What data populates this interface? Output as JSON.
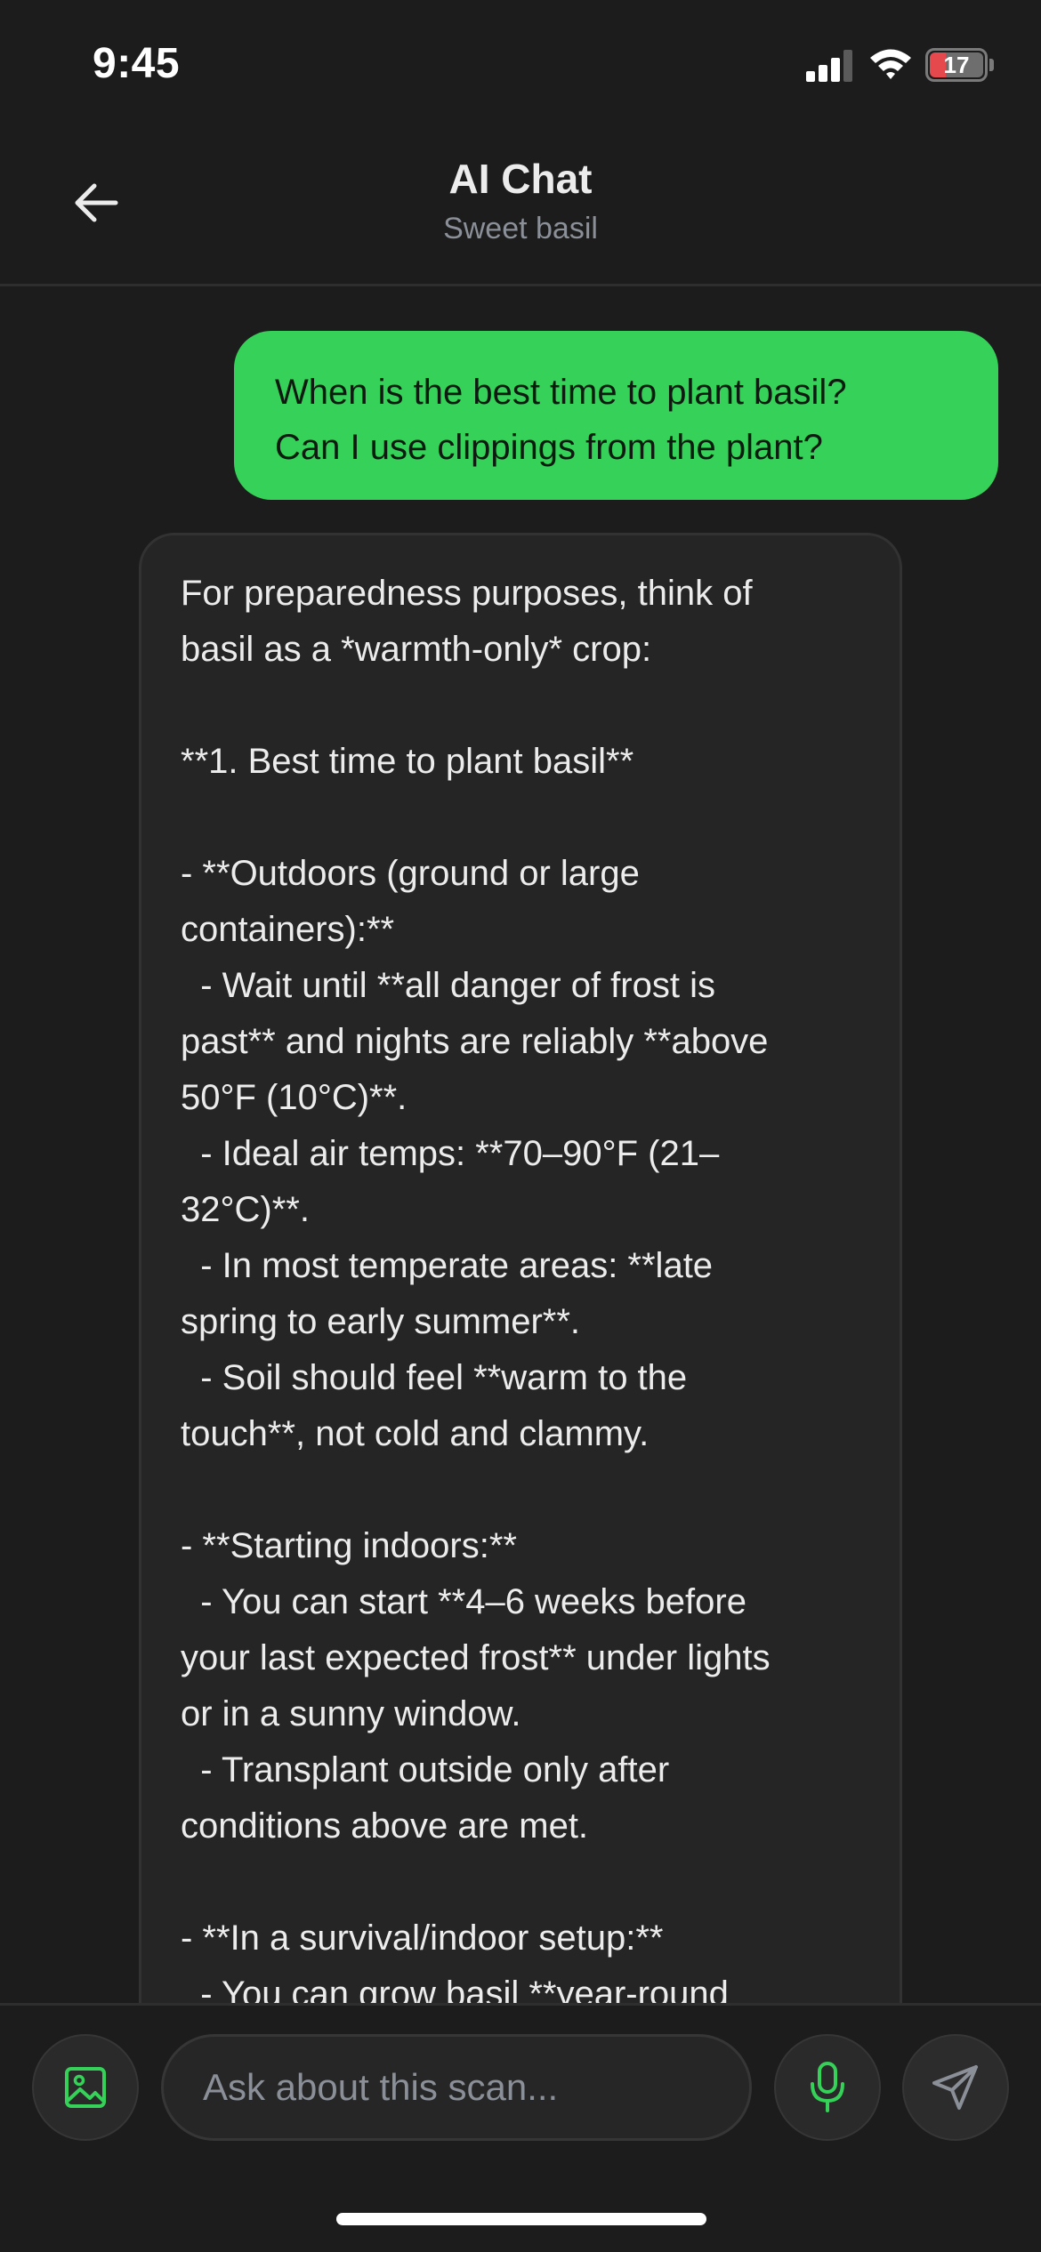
{
  "status_bar": {
    "time": "9:45",
    "battery": "17",
    "icons": [
      "cellular-signal-icon",
      "wifi-icon",
      "battery-icon"
    ]
  },
  "header": {
    "title": "AI Chat",
    "subtitle": "Sweet basil",
    "back_icon": "arrow-left-icon"
  },
  "messages": {
    "user": {
      "lines": [
        "When is the best time to plant basil?",
        "Can I use clippings from the plant?"
      ]
    },
    "assistant": {
      "lines": [
        "For preparedness purposes, think of",
        "basil as a *warmth-only* crop:",
        "",
        "**1. Best time to plant basil**",
        "",
        "- **Outdoors (ground or large",
        "containers):**",
        "  - Wait until **all danger of frost is",
        "past** and nights are reliably **above",
        "50°F (10°C)**.",
        "  - Ideal air temps: **70–90°F (21–",
        "32°C)**.",
        "  - In most temperate areas: **late",
        "spring to early summer**.",
        "  - Soil should feel **warm to the",
        "touch**, not cold and clammy.",
        "",
        "- **Starting indoors:**",
        "  - You can start **4–6 weeks before",
        "your last expected frost** under lights",
        "or in a sunny window.",
        "  - Transplant outside only after",
        "conditions above are met.",
        "",
        "- **In a survival/indoor setup:**",
        "  - You can grow basil **year-round"
      ]
    }
  },
  "input_bar": {
    "placeholder": "Ask about this scan...",
    "value": "",
    "image_icon": "image-icon",
    "mic_icon": "microphone-icon",
    "send_icon": "send-icon"
  },
  "colors": {
    "background": "#1c1c1c",
    "user_bubble": "#36d158",
    "assistant_bubble": "#252525",
    "accent": "#36d158",
    "battery_low": "#e5484d"
  }
}
